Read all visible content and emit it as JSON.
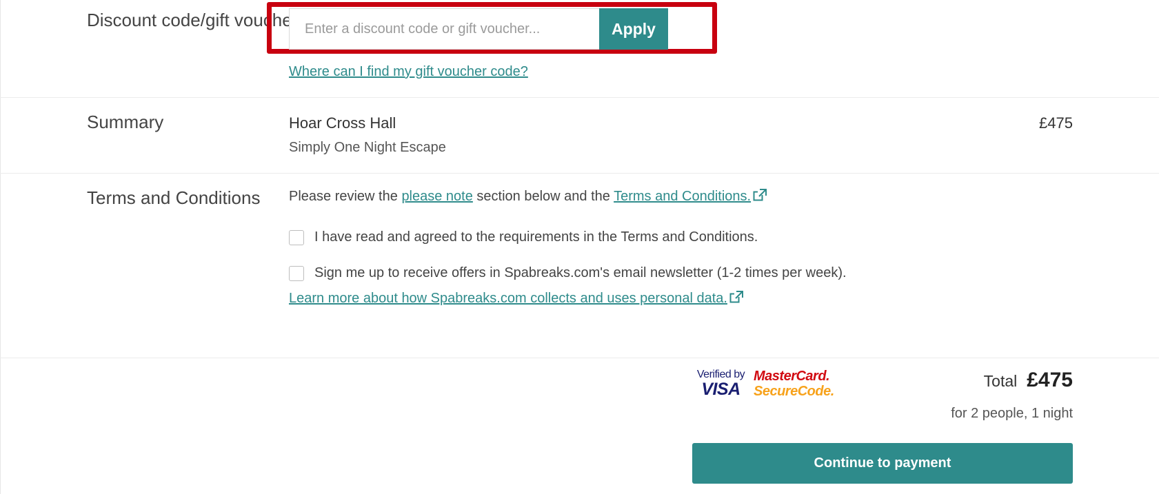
{
  "discount": {
    "label": "Discount code/gift voucher",
    "input_placeholder": "Enter a discount code or gift voucher...",
    "input_value": "",
    "apply_label": "Apply",
    "help_link": "Where can I find my gift voucher code?"
  },
  "summary": {
    "label": "Summary",
    "venue": "Hoar Cross Hall",
    "package": "Simply One Night Escape",
    "price": "£475"
  },
  "terms": {
    "label": "Terms and Conditions",
    "intro_prefix": "Please review the",
    "intro_link1": "please note",
    "intro_middle": "section below and the",
    "intro_link2": "Terms and Conditions.",
    "agree_text": "I have read and agreed to the requirements in the Terms and Conditions.",
    "newsletter_text": "Sign me up to receive offers in Spabreaks.com's email newsletter (1-2 times per week).",
    "privacy_link": "Learn more about how Spabreaks.com collects and uses personal data."
  },
  "payment": {
    "visa_top": "Verified by",
    "visa_bottom": "VISA",
    "mc_top": "MasterCard.",
    "mc_bottom": "SecureCode.",
    "total_label": "Total",
    "total_amount": "£475",
    "total_note": "for 2 people, 1 night",
    "continue_label": "Continue to payment"
  },
  "colors": {
    "accent": "#2e8b8b",
    "highlight": "#c8000f"
  }
}
